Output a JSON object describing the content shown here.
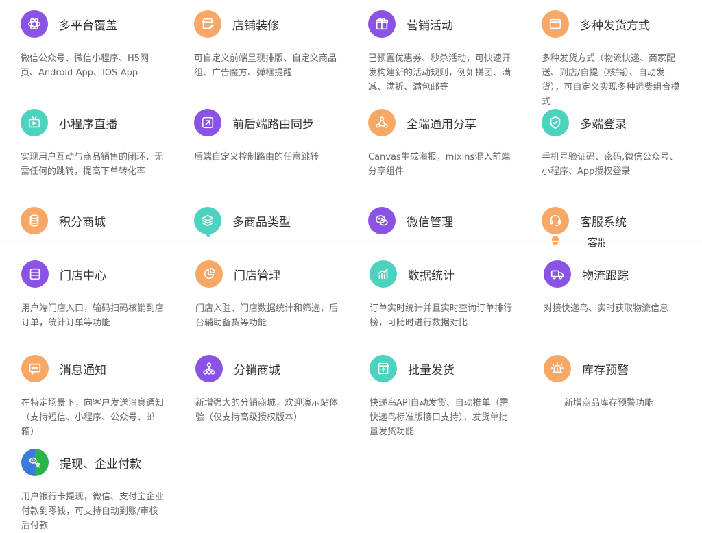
{
  "features": [
    {
      "title": "多平台覆盖",
      "desc": "微信公众号、微信小程序、H5网页、Android-App、IOS-App"
    },
    {
      "title": "店铺装修",
      "desc": "可自定义前端呈现排版、自定义商品组、广告魔方、弹框提醒"
    },
    {
      "title": "营销活动",
      "desc": "已预置优惠券、秒杀活动，可快速开发构建新的活动规则，例如拼团、满减、满折、满包邮等"
    },
    {
      "title": "多种发货方式",
      "desc": "多种发货方式（物流快递、商家配送、到店/自提（核销）、自动发货），可自定义实现多种运费组合模式"
    },
    {
      "title": "小程序直播",
      "desc": "实现用户互动与商品销售的闭环，无需任何的跳转，提高下单转化率"
    },
    {
      "title": "前后端路由同步",
      "desc": "后端自定义控制路由的任意跳转"
    },
    {
      "title": "全端通用分享",
      "desc": "Canvas生成海报，mixins混入前端分享组件"
    },
    {
      "title": "多端登录",
      "desc": "手机号验证码、密码,微信公众号、小程序、App授权登录"
    },
    {
      "title": "积分商城",
      "desc": ""
    },
    {
      "title": "多商品类型",
      "desc": ""
    },
    {
      "title": "微信管理",
      "desc": ""
    },
    {
      "title": "客服系统",
      "desc": ""
    },
    {
      "title": "门店中心",
      "desc": "用户端门店入口，输码扫码核销到店订单，统计订单等功能"
    },
    {
      "title": "门店管理",
      "desc": "门店入驻、门店数据统计和筛选，后台辅助备货等功能"
    },
    {
      "title": "数据统计",
      "desc": "订单实时统计并且实时查询订单排行榜，可随时进行数据对比"
    },
    {
      "title": "物流跟踪",
      "desc": "对接快递鸟、实时获取物流信息"
    },
    {
      "title": "消息通知",
      "desc": "在特定场景下，向客户发送消息通知（支持短信、小程序、公众号、邮箱）"
    },
    {
      "title": "分销商城",
      "desc": "新增强大的分销商城，欢迎演示站体验（仅支持高级授权版本）"
    },
    {
      "title": "批量发货",
      "desc": "快递鸟API自动发货、自动推单（需快递鸟标准版接口支持），发货单批量发货功能"
    },
    {
      "title": "库存预警",
      "desc": "新增商品库存预警功能"
    },
    {
      "title": "提现、企业付款",
      "desc": "用户银行卡提现，微信、支付宝企业付款到零钱，可支持自动到账/审核后付款"
    }
  ],
  "fragment_text": "客服",
  "colors": {
    "purple": "#8a53e6",
    "orange": "#f8a866",
    "teal": "#4dd2c0",
    "title": "#333333",
    "desc": "#666666"
  }
}
